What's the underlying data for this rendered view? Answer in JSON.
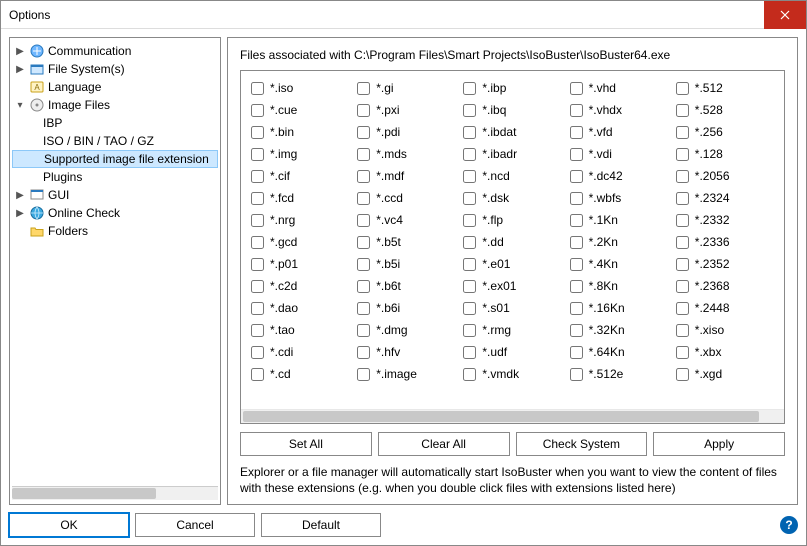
{
  "window": {
    "title": "Options"
  },
  "tree": {
    "items": [
      {
        "label": "Communication",
        "expander": "▶",
        "icon": "comm",
        "depth": 0
      },
      {
        "label": "File System(s)",
        "expander": "▶",
        "icon": "fs",
        "depth": 0
      },
      {
        "label": "Language",
        "expander": "",
        "icon": "lang",
        "depth": 0
      },
      {
        "label": "Image Files",
        "expander": "▾",
        "icon": "img",
        "depth": 0
      },
      {
        "label": "IBP",
        "expander": "",
        "icon": "none",
        "depth": 1
      },
      {
        "label": "ISO / BIN / TAO / GZ",
        "expander": "",
        "icon": "none",
        "depth": 1
      },
      {
        "label": "Supported image file extension",
        "expander": "",
        "icon": "none",
        "depth": 1,
        "selected": true
      },
      {
        "label": "Plugins",
        "expander": "",
        "icon": "none",
        "depth": 1
      },
      {
        "label": "GUI",
        "expander": "▶",
        "icon": "gui",
        "depth": 0
      },
      {
        "label": "Online Check",
        "expander": "▶",
        "icon": "online",
        "depth": 0
      },
      {
        "label": "Folders",
        "expander": "",
        "icon": "folder",
        "depth": 0
      }
    ]
  },
  "main": {
    "header": "Files associated with C:\\Program Files\\Smart Projects\\IsoBuster\\IsoBuster64.exe",
    "extensions": [
      "*.iso",
      "*.cue",
      "*.bin",
      "*.img",
      "*.cif",
      "*.fcd",
      "*.nrg",
      "*.gcd",
      "*.p01",
      "*.c2d",
      "*.dao",
      "*.tao",
      "*.cdi",
      "*.cd",
      "*.gi",
      "*.pxi",
      "*.pdi",
      "*.mds",
      "*.mdf",
      "*.ccd",
      "*.vc4",
      "*.b5t",
      "*.b5i",
      "*.b6t",
      "*.b6i",
      "*.dmg",
      "*.hfv",
      "*.image",
      "*.ibp",
      "*.ibq",
      "*.ibdat",
      "*.ibadr",
      "*.ncd",
      "*.dsk",
      "*.flp",
      "*.dd",
      "*.e01",
      "*.ex01",
      "*.s01",
      "*.rmg",
      "*.udf",
      "*.vmdk",
      "*.vhd",
      "*.vhdx",
      "*.vfd",
      "*.vdi",
      "*.dc42",
      "*.wbfs",
      "*.1Kn",
      "*.2Kn",
      "*.4Kn",
      "*.8Kn",
      "*.16Kn",
      "*.32Kn",
      "*.64Kn",
      "*.512e",
      "*.512",
      "*.528",
      "*.256",
      "*.128",
      "*.2056",
      "*.2324",
      "*.2332",
      "*.2336",
      "*.2352",
      "*.2368",
      "*.2448",
      "*.xiso",
      "*.xbx",
      "*.xgd"
    ],
    "buttons": {
      "set_all": "Set All",
      "clear_all": "Clear All",
      "check_system": "Check System",
      "apply": "Apply"
    },
    "explain": "Explorer or a file manager will automatically start IsoBuster when you want to view the content of files with these extensions (e.g. when you double click files with extensions listed here)"
  },
  "footer": {
    "ok": "OK",
    "cancel": "Cancel",
    "default": "Default"
  }
}
